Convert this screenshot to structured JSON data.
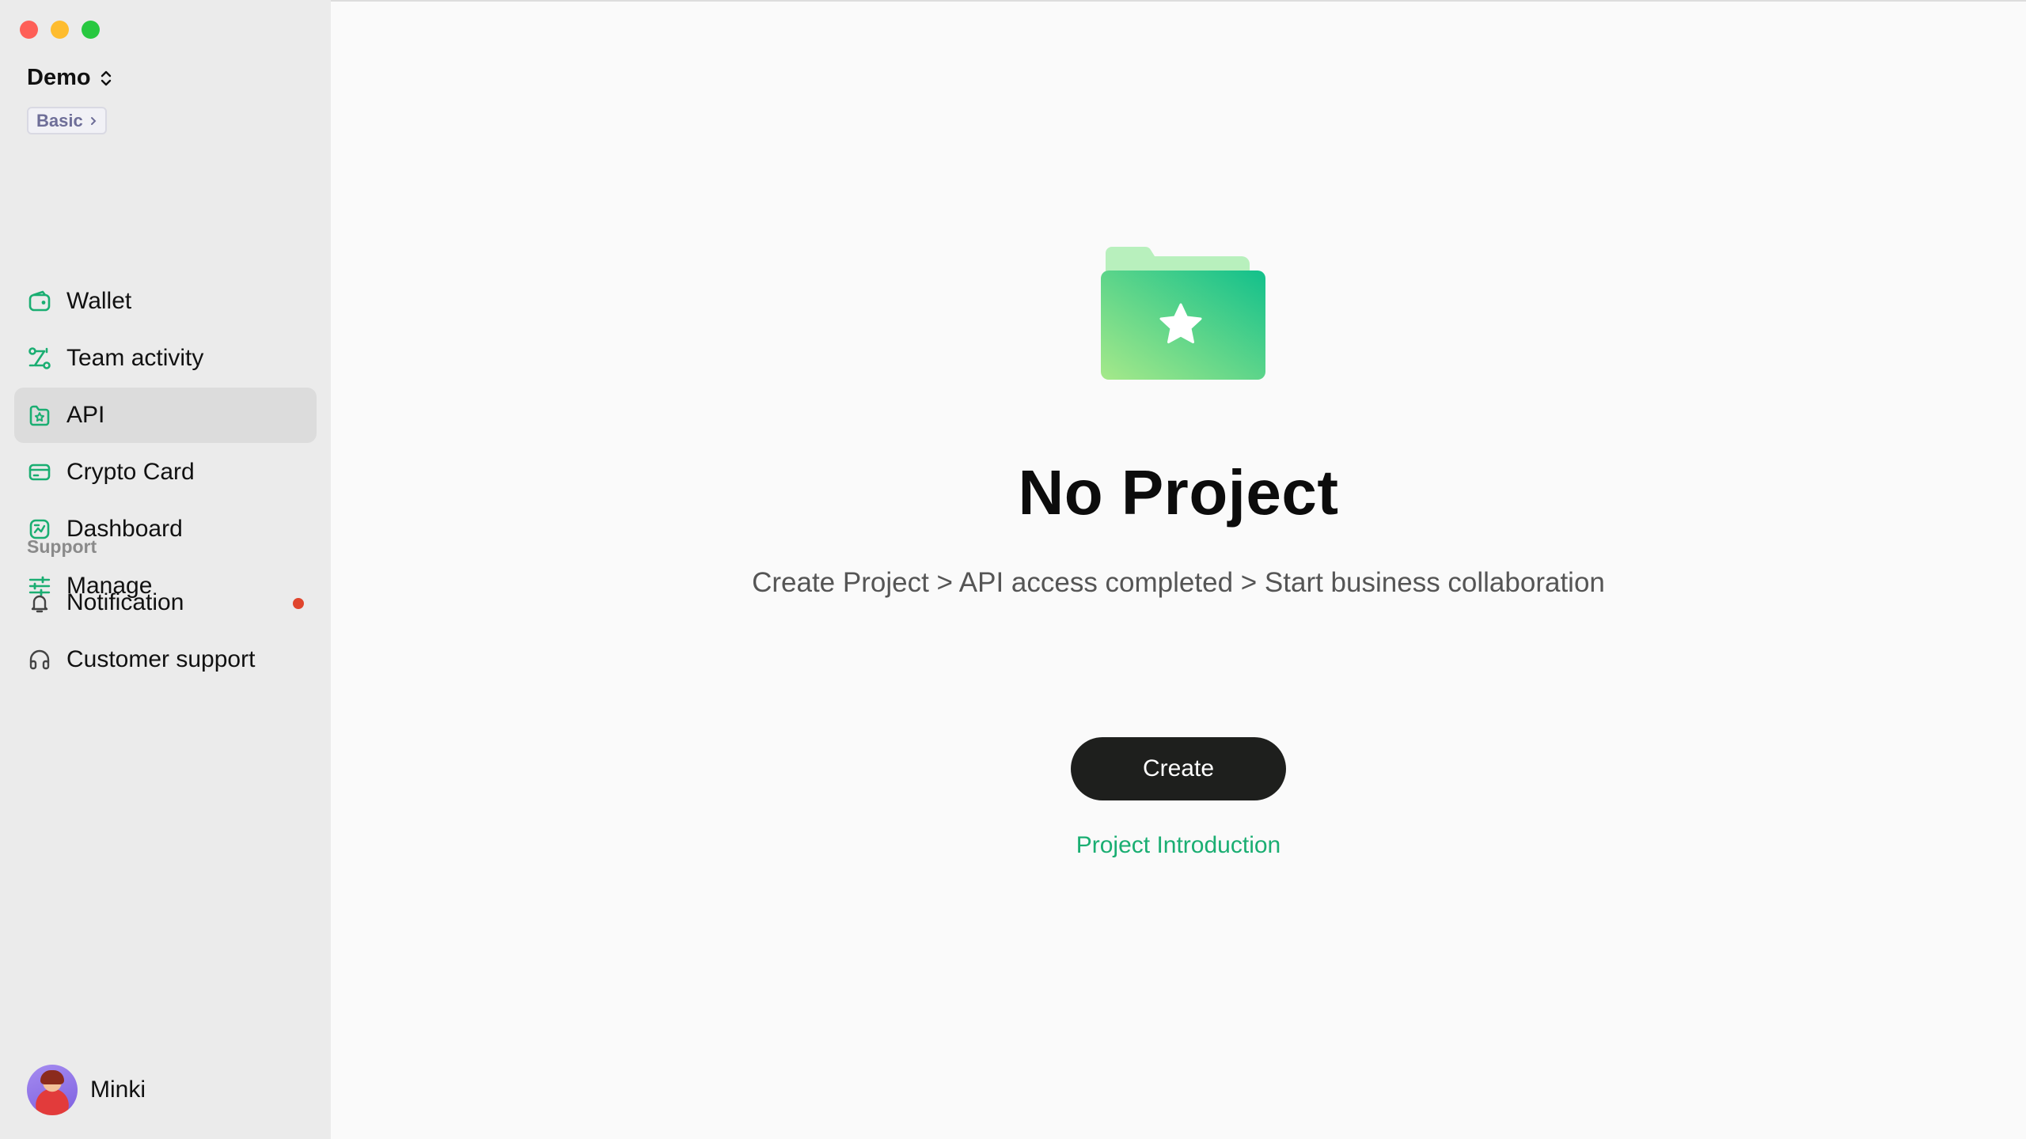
{
  "workspace": {
    "name": "Demo",
    "plan": "Basic"
  },
  "nav": [
    {
      "label": "Wallet",
      "icon": "wallet-icon"
    },
    {
      "label": "Team activity",
      "icon": "team-activity-icon"
    },
    {
      "label": "API",
      "icon": "api-icon",
      "active": true
    },
    {
      "label": "Crypto Card",
      "icon": "card-icon"
    },
    {
      "label": "Dashboard",
      "icon": "dashboard-icon"
    },
    {
      "label": "Manage",
      "icon": "sliders-icon"
    }
  ],
  "support": {
    "heading": "Support",
    "items": [
      {
        "label": "Notification",
        "icon": "bell-icon",
        "has_unread": true
      },
      {
        "label": "Customer support",
        "icon": "headphones-icon"
      }
    ]
  },
  "user": {
    "name": "Minki"
  },
  "empty_state": {
    "title": "No Project",
    "subtitle": "Create Project > API access completed > Start business collaboration",
    "create_label": "Create",
    "link_label": "Project Introduction",
    "icon": "folder-star-icon"
  },
  "colors": {
    "accent": "#1aae72",
    "button_dark": "#1e1f1d",
    "notification_dot": "#e0452d"
  }
}
